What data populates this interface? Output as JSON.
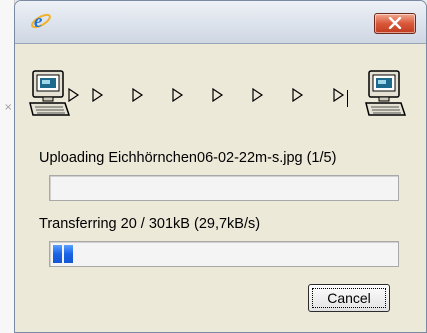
{
  "window": {
    "icon": "ie-icon",
    "close_icon": "close-icon"
  },
  "transfer_graphic": {
    "source_icon": "computer-icon",
    "destination_icon": "computer-icon",
    "arrow_icon": "triangle-right-icon",
    "arrow_count": 7
  },
  "upload": {
    "status_text": "Uploading Eichhörnchen06-02-22m-s.jpg (1/5)",
    "progress_fraction": 0
  },
  "transfer": {
    "status_text": "Transferring 20 / 301kB (29,7kB/s)",
    "progress_fraction": 0.066
  },
  "buttons": {
    "cancel_label": "Cancel"
  },
  "colors": {
    "progress_fill": "#1863e8",
    "close_button": "#d9583a",
    "dialog_background": "#ece9d8"
  }
}
